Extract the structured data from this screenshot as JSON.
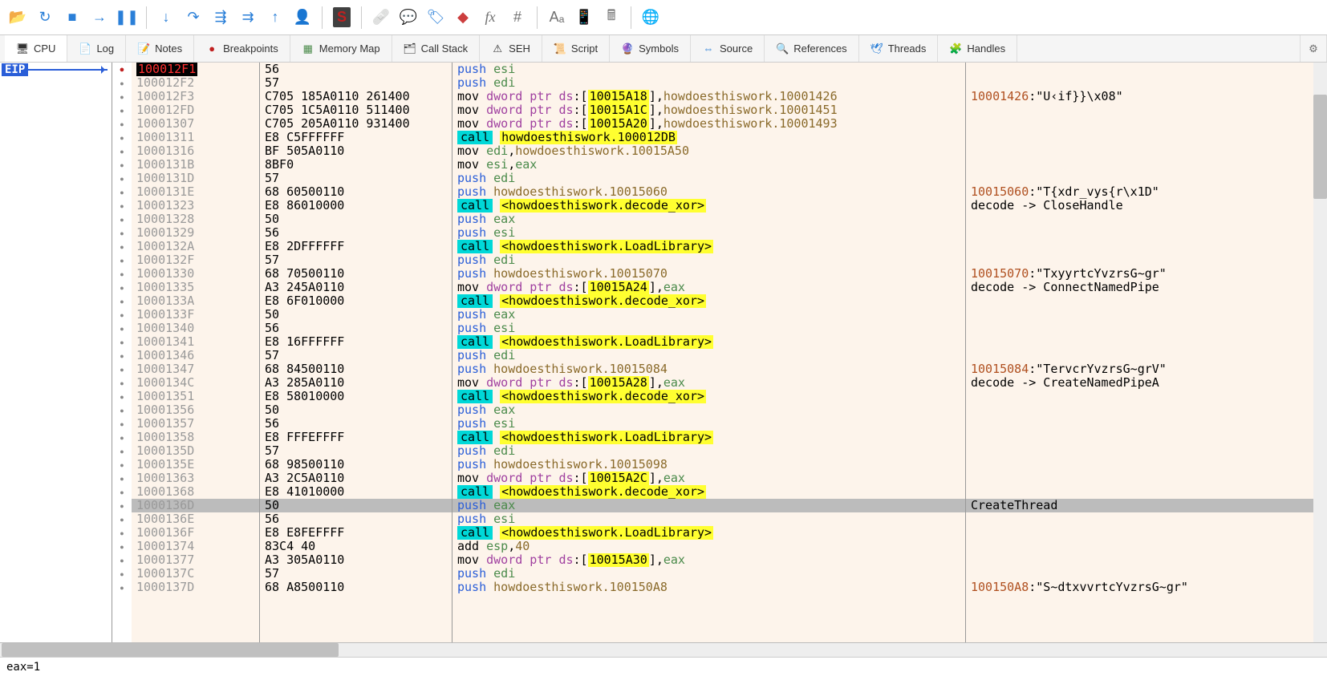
{
  "toolbar_icons": [
    {
      "name": "open-folder-icon",
      "glyph": "📂"
    },
    {
      "name": "restart-icon",
      "glyph": "↻",
      "class": "ico-blue"
    },
    {
      "name": "stop-icon",
      "glyph": "■",
      "class": "ico-blue"
    },
    {
      "name": "run-icon",
      "glyph": "→",
      "class": "ico-blue"
    },
    {
      "name": "pause-icon",
      "glyph": "❚❚",
      "class": "ico-blue"
    },
    {
      "name": "sep"
    },
    {
      "name": "step-into-icon",
      "glyph": "↓",
      "class": "ico-blue"
    },
    {
      "name": "step-over-icon",
      "glyph": "↷",
      "class": "ico-blue"
    },
    {
      "name": "trace-into-icon",
      "glyph": "⇶",
      "class": "ico-blue"
    },
    {
      "name": "trace-over-icon",
      "glyph": "⇉",
      "class": "ico-blue"
    },
    {
      "name": "run-till-return-icon",
      "glyph": "↑",
      "class": "ico-blue"
    },
    {
      "name": "run-to-user-icon",
      "glyph": "👤",
      "class": "ico-blue"
    },
    {
      "name": "sep"
    },
    {
      "name": "scylla-icon",
      "glyph": "S",
      "class": "ico-gray",
      "style": "background:#404040;color:#c02020;font-weight:bold;padding:2px 5px;border-radius:2px;"
    },
    {
      "name": "sep"
    },
    {
      "name": "patches-icon",
      "glyph": "🩹"
    },
    {
      "name": "comments-icon",
      "glyph": "💬"
    },
    {
      "name": "labels-icon",
      "glyph": "🏷",
      "class": "ico-blue"
    },
    {
      "name": "bookmarks-icon",
      "glyph": "◆",
      "class": "ico-red"
    },
    {
      "name": "functions-icon",
      "glyph": "fx",
      "class": "ico-gray",
      "style": "font-style:italic;font-family:serif;"
    },
    {
      "name": "variables-icon",
      "glyph": "#",
      "class": "ico-gray"
    },
    {
      "name": "sep"
    },
    {
      "name": "strings-icon",
      "glyph": "Aₐ",
      "class": "ico-gray"
    },
    {
      "name": "modules-icon",
      "glyph": "📱"
    },
    {
      "name": "calculator-icon",
      "glyph": "🖩",
      "class": "ico-gray"
    },
    {
      "name": "sep"
    },
    {
      "name": "settings-icon",
      "glyph": "🌐"
    }
  ],
  "tabs": [
    {
      "name": "cpu",
      "label": "CPU",
      "icon": "🖥",
      "active": true
    },
    {
      "name": "log",
      "label": "Log",
      "icon": "📄"
    },
    {
      "name": "notes",
      "label": "Notes",
      "icon": "📝"
    },
    {
      "name": "breakpoints",
      "label": "Breakpoints",
      "icon": "●",
      "iconColor": "#c02020"
    },
    {
      "name": "memory-map",
      "label": "Memory Map",
      "icon": "▦",
      "iconColor": "#4a8a4a"
    },
    {
      "name": "call-stack",
      "label": "Call Stack",
      "icon": "🗂"
    },
    {
      "name": "seh",
      "label": "SEH",
      "icon": "⚠"
    },
    {
      "name": "script",
      "label": "Script",
      "icon": "📜"
    },
    {
      "name": "symbols",
      "label": "Symbols",
      "icon": "🔮"
    },
    {
      "name": "source",
      "label": "Source",
      "icon": "⇔",
      "iconColor": "#2a7fd8"
    },
    {
      "name": "references",
      "label": "References",
      "icon": "🔍"
    },
    {
      "name": "threads",
      "label": "Threads",
      "icon": "🕊",
      "iconColor": "#2a7fd8"
    },
    {
      "name": "handles",
      "label": "Handles",
      "icon": "🧩"
    }
  ],
  "eip_label": "EIP",
  "status": "eax=1",
  "rows": [
    {
      "addr": "100012F1",
      "bytes": "56",
      "asm": [
        {
          "t": "push ",
          "c": "mn-push"
        },
        {
          "t": "esi",
          "c": "reg"
        }
      ],
      "eip": true,
      "bp": true
    },
    {
      "addr": "100012F2",
      "bytes": "57",
      "asm": [
        {
          "t": "push ",
          "c": "mn-push"
        },
        {
          "t": "edi",
          "c": "reg"
        }
      ]
    },
    {
      "addr": "100012F3",
      "bytes": "C705 185A0110 261400",
      "asm": [
        {
          "t": "mov ",
          "c": "mn-mov"
        },
        {
          "t": "dword ptr ",
          "c": "ptr"
        },
        {
          "t": "ds",
          "c": "segds"
        },
        {
          "t": ":[",
          "c": ""
        },
        {
          "t": "10015A18",
          "c": "hl-yellow"
        },
        {
          "t": "],",
          "c": ""
        },
        {
          "t": "howdoesthiswork.10001426",
          "c": "sym"
        }
      ],
      "cmt": [
        {
          "t": "10001426",
          "c": "cmt-addr"
        },
        {
          "t": ":\"U‹if}}\\x08\"",
          "c": "cmt-text"
        }
      ]
    },
    {
      "addr": "100012FD",
      "bytes": "C705 1C5A0110 511400",
      "asm": [
        {
          "t": "mov ",
          "c": "mn-mov"
        },
        {
          "t": "dword ptr ",
          "c": "ptr"
        },
        {
          "t": "ds",
          "c": "segds"
        },
        {
          "t": ":[",
          "c": ""
        },
        {
          "t": "10015A1C",
          "c": "hl-yellow"
        },
        {
          "t": "],",
          "c": ""
        },
        {
          "t": "howdoesthiswork.10001451",
          "c": "sym"
        }
      ]
    },
    {
      "addr": "10001307",
      "bytes": "C705 205A0110 931400",
      "asm": [
        {
          "t": "mov ",
          "c": "mn-mov"
        },
        {
          "t": "dword ptr ",
          "c": "ptr"
        },
        {
          "t": "ds",
          "c": "segds"
        },
        {
          "t": ":[",
          "c": ""
        },
        {
          "t": "10015A20",
          "c": "hl-yellow"
        },
        {
          "t": "],",
          "c": ""
        },
        {
          "t": "howdoesthiswork.10001493",
          "c": "sym"
        }
      ]
    },
    {
      "addr": "10001311",
      "bytes": "E8 C5FFFFFF",
      "asm": [
        {
          "t": "call",
          "c": "mn-call"
        },
        {
          "t": " ",
          "c": ""
        },
        {
          "t": "howdoesthiswork.100012DB",
          "c": "hl-yellow"
        }
      ]
    },
    {
      "addr": "10001316",
      "bytes": "BF 505A0110",
      "asm": [
        {
          "t": "mov ",
          "c": "mn-mov"
        },
        {
          "t": "edi",
          "c": "reg"
        },
        {
          "t": ",",
          "c": ""
        },
        {
          "t": "howdoesthiswork.10015A50",
          "c": "sym"
        }
      ]
    },
    {
      "addr": "1000131B",
      "bytes": "8BF0",
      "asm": [
        {
          "t": "mov ",
          "c": "mn-mov"
        },
        {
          "t": "esi",
          "c": "reg"
        },
        {
          "t": ",",
          "c": ""
        },
        {
          "t": "eax",
          "c": "reg"
        }
      ]
    },
    {
      "addr": "1000131D",
      "bytes": "57",
      "asm": [
        {
          "t": "push ",
          "c": "mn-push"
        },
        {
          "t": "edi",
          "c": "reg"
        }
      ]
    },
    {
      "addr": "1000131E",
      "bytes": "68 60500110",
      "asm": [
        {
          "t": "push ",
          "c": "mn-push"
        },
        {
          "t": "howdoesthiswork.10015060",
          "c": "sym"
        }
      ],
      "cmt": [
        {
          "t": "10015060",
          "c": "cmt-addr"
        },
        {
          "t": ":\"T{xdr_vys{r\\x1D\"",
          "c": "cmt-text"
        }
      ]
    },
    {
      "addr": "10001323",
      "bytes": "E8 86010000",
      "asm": [
        {
          "t": "call",
          "c": "mn-call"
        },
        {
          "t": " ",
          "c": ""
        },
        {
          "t": "<howdoesthiswork.decode_xor>",
          "c": "hl-yellow"
        }
      ],
      "cmt": [
        {
          "t": "decode -> CloseHandle",
          "c": "cmt-text"
        }
      ]
    },
    {
      "addr": "10001328",
      "bytes": "50",
      "asm": [
        {
          "t": "push ",
          "c": "mn-push"
        },
        {
          "t": "eax",
          "c": "reg"
        }
      ]
    },
    {
      "addr": "10001329",
      "bytes": "56",
      "asm": [
        {
          "t": "push ",
          "c": "mn-push"
        },
        {
          "t": "esi",
          "c": "reg"
        }
      ]
    },
    {
      "addr": "1000132A",
      "bytes": "E8 2DFFFFFF",
      "asm": [
        {
          "t": "call",
          "c": "mn-call"
        },
        {
          "t": " ",
          "c": ""
        },
        {
          "t": "<howdoesthiswork.LoadLibrary>",
          "c": "hl-yellow"
        }
      ]
    },
    {
      "addr": "1000132F",
      "bytes": "57",
      "asm": [
        {
          "t": "push ",
          "c": "mn-push"
        },
        {
          "t": "edi",
          "c": "reg"
        }
      ]
    },
    {
      "addr": "10001330",
      "bytes": "68 70500110",
      "asm": [
        {
          "t": "push ",
          "c": "mn-push"
        },
        {
          "t": "howdoesthiswork.10015070",
          "c": "sym"
        }
      ],
      "cmt": [
        {
          "t": "10015070",
          "c": "cmt-addr"
        },
        {
          "t": ":\"TxyyrtcYvzrsG~gr\"",
          "c": "cmt-text"
        }
      ]
    },
    {
      "addr": "10001335",
      "bytes": "A3 245A0110",
      "asm": [
        {
          "t": "mov ",
          "c": "mn-mov"
        },
        {
          "t": "dword ptr ",
          "c": "ptr"
        },
        {
          "t": "ds",
          "c": "segds"
        },
        {
          "t": ":[",
          "c": ""
        },
        {
          "t": "10015A24",
          "c": "hl-yellow"
        },
        {
          "t": "],",
          "c": ""
        },
        {
          "t": "eax",
          "c": "reg"
        }
      ],
      "cmt": [
        {
          "t": "decode -> ConnectNamedPipe",
          "c": "cmt-text"
        }
      ]
    },
    {
      "addr": "1000133A",
      "bytes": "E8 6F010000",
      "asm": [
        {
          "t": "call",
          "c": "mn-call"
        },
        {
          "t": " ",
          "c": ""
        },
        {
          "t": "<howdoesthiswork.decode_xor>",
          "c": "hl-yellow"
        }
      ]
    },
    {
      "addr": "1000133F",
      "bytes": "50",
      "asm": [
        {
          "t": "push ",
          "c": "mn-push"
        },
        {
          "t": "eax",
          "c": "reg"
        }
      ]
    },
    {
      "addr": "10001340",
      "bytes": "56",
      "asm": [
        {
          "t": "push ",
          "c": "mn-push"
        },
        {
          "t": "esi",
          "c": "reg"
        }
      ]
    },
    {
      "addr": "10001341",
      "bytes": "E8 16FFFFFF",
      "asm": [
        {
          "t": "call",
          "c": "mn-call"
        },
        {
          "t": " ",
          "c": ""
        },
        {
          "t": "<howdoesthiswork.LoadLibrary>",
          "c": "hl-yellow"
        }
      ]
    },
    {
      "addr": "10001346",
      "bytes": "57",
      "asm": [
        {
          "t": "push ",
          "c": "mn-push"
        },
        {
          "t": "edi",
          "c": "reg"
        }
      ]
    },
    {
      "addr": "10001347",
      "bytes": "68 84500110",
      "asm": [
        {
          "t": "push ",
          "c": "mn-push"
        },
        {
          "t": "howdoesthiswork.10015084",
          "c": "sym"
        }
      ],
      "cmt": [
        {
          "t": "10015084",
          "c": "cmt-addr"
        },
        {
          "t": ":\"TervcrYvzrsG~grV\"",
          "c": "cmt-text"
        }
      ]
    },
    {
      "addr": "1000134C",
      "bytes": "A3 285A0110",
      "asm": [
        {
          "t": "mov ",
          "c": "mn-mov"
        },
        {
          "t": "dword ptr ",
          "c": "ptr"
        },
        {
          "t": "ds",
          "c": "segds"
        },
        {
          "t": ":[",
          "c": ""
        },
        {
          "t": "10015A28",
          "c": "hl-yellow"
        },
        {
          "t": "],",
          "c": ""
        },
        {
          "t": "eax",
          "c": "reg"
        }
      ],
      "cmt": [
        {
          "t": "decode -> CreateNamedPipeA",
          "c": "cmt-text"
        }
      ]
    },
    {
      "addr": "10001351",
      "bytes": "E8 58010000",
      "asm": [
        {
          "t": "call",
          "c": "mn-call"
        },
        {
          "t": " ",
          "c": ""
        },
        {
          "t": "<howdoesthiswork.decode_xor>",
          "c": "hl-yellow"
        }
      ]
    },
    {
      "addr": "10001356",
      "bytes": "50",
      "asm": [
        {
          "t": "push ",
          "c": "mn-push"
        },
        {
          "t": "eax",
          "c": "reg"
        }
      ]
    },
    {
      "addr": "10001357",
      "bytes": "56",
      "asm": [
        {
          "t": "push ",
          "c": "mn-push"
        },
        {
          "t": "esi",
          "c": "reg"
        }
      ]
    },
    {
      "addr": "10001358",
      "bytes": "E8 FFFEFFFF",
      "asm": [
        {
          "t": "call",
          "c": "mn-call"
        },
        {
          "t": " ",
          "c": ""
        },
        {
          "t": "<howdoesthiswork.LoadLibrary>",
          "c": "hl-yellow"
        }
      ]
    },
    {
      "addr": "1000135D",
      "bytes": "57",
      "asm": [
        {
          "t": "push ",
          "c": "mn-push"
        },
        {
          "t": "edi",
          "c": "reg"
        }
      ]
    },
    {
      "addr": "1000135E",
      "bytes": "68 98500110",
      "asm": [
        {
          "t": "push ",
          "c": "mn-push"
        },
        {
          "t": "howdoesthiswork.10015098",
          "c": "sym"
        }
      ]
    },
    {
      "addr": "10001363",
      "bytes": "A3 2C5A0110",
      "asm": [
        {
          "t": "mov ",
          "c": "mn-mov"
        },
        {
          "t": "dword ptr ",
          "c": "ptr"
        },
        {
          "t": "ds",
          "c": "segds"
        },
        {
          "t": ":[",
          "c": ""
        },
        {
          "t": "10015A2C",
          "c": "hl-yellow"
        },
        {
          "t": "],",
          "c": ""
        },
        {
          "t": "eax",
          "c": "reg"
        }
      ]
    },
    {
      "addr": "10001368",
      "bytes": "E8 41010000",
      "asm": [
        {
          "t": "call",
          "c": "mn-call"
        },
        {
          "t": " ",
          "c": ""
        },
        {
          "t": "<howdoesthiswork.decode_xor>",
          "c": "hl-yellow"
        }
      ]
    },
    {
      "addr": "1000136D",
      "bytes": "50",
      "asm": [
        {
          "t": "push ",
          "c": "mn-push"
        },
        {
          "t": "eax",
          "c": "reg"
        }
      ],
      "sel": true,
      "cmt": [
        {
          "t": "CreateThread",
          "c": "cmt-text"
        }
      ]
    },
    {
      "addr": "1000136E",
      "bytes": "56",
      "asm": [
        {
          "t": "push ",
          "c": "mn-push"
        },
        {
          "t": "esi",
          "c": "reg"
        }
      ]
    },
    {
      "addr": "1000136F",
      "bytes": "E8 E8FEFFFF",
      "asm": [
        {
          "t": "call",
          "c": "mn-call"
        },
        {
          "t": " ",
          "c": ""
        },
        {
          "t": "<howdoesthiswork.LoadLibrary>",
          "c": "hl-yellow"
        }
      ]
    },
    {
      "addr": "10001374",
      "bytes": "83C4 40",
      "asm": [
        {
          "t": "add ",
          "c": "mn-add"
        },
        {
          "t": "esp",
          "c": "reg"
        },
        {
          "t": ",",
          "c": ""
        },
        {
          "t": "40",
          "c": "imm"
        }
      ]
    },
    {
      "addr": "10001377",
      "bytes": "A3 305A0110",
      "asm": [
        {
          "t": "mov ",
          "c": "mn-mov"
        },
        {
          "t": "dword ptr ",
          "c": "ptr"
        },
        {
          "t": "ds",
          "c": "segds"
        },
        {
          "t": ":[",
          "c": ""
        },
        {
          "t": "10015A30",
          "c": "hl-yellow"
        },
        {
          "t": "],",
          "c": ""
        },
        {
          "t": "eax",
          "c": "reg"
        }
      ]
    },
    {
      "addr": "1000137C",
      "bytes": "57",
      "asm": [
        {
          "t": "push ",
          "c": "mn-push"
        },
        {
          "t": "edi",
          "c": "reg"
        }
      ]
    },
    {
      "addr": "1000137D",
      "bytes": "68 A8500110",
      "asm": [
        {
          "t": "push ",
          "c": "mn-push"
        },
        {
          "t": "howdoesthiswork.100150A8",
          "c": "sym"
        }
      ],
      "cmt": [
        {
          "t": "100150A8",
          "c": "cmt-addr"
        },
        {
          "t": ":\"S~dtxvvrtcYvzrsG~gr\"",
          "c": "cmt-text"
        }
      ]
    }
  ]
}
